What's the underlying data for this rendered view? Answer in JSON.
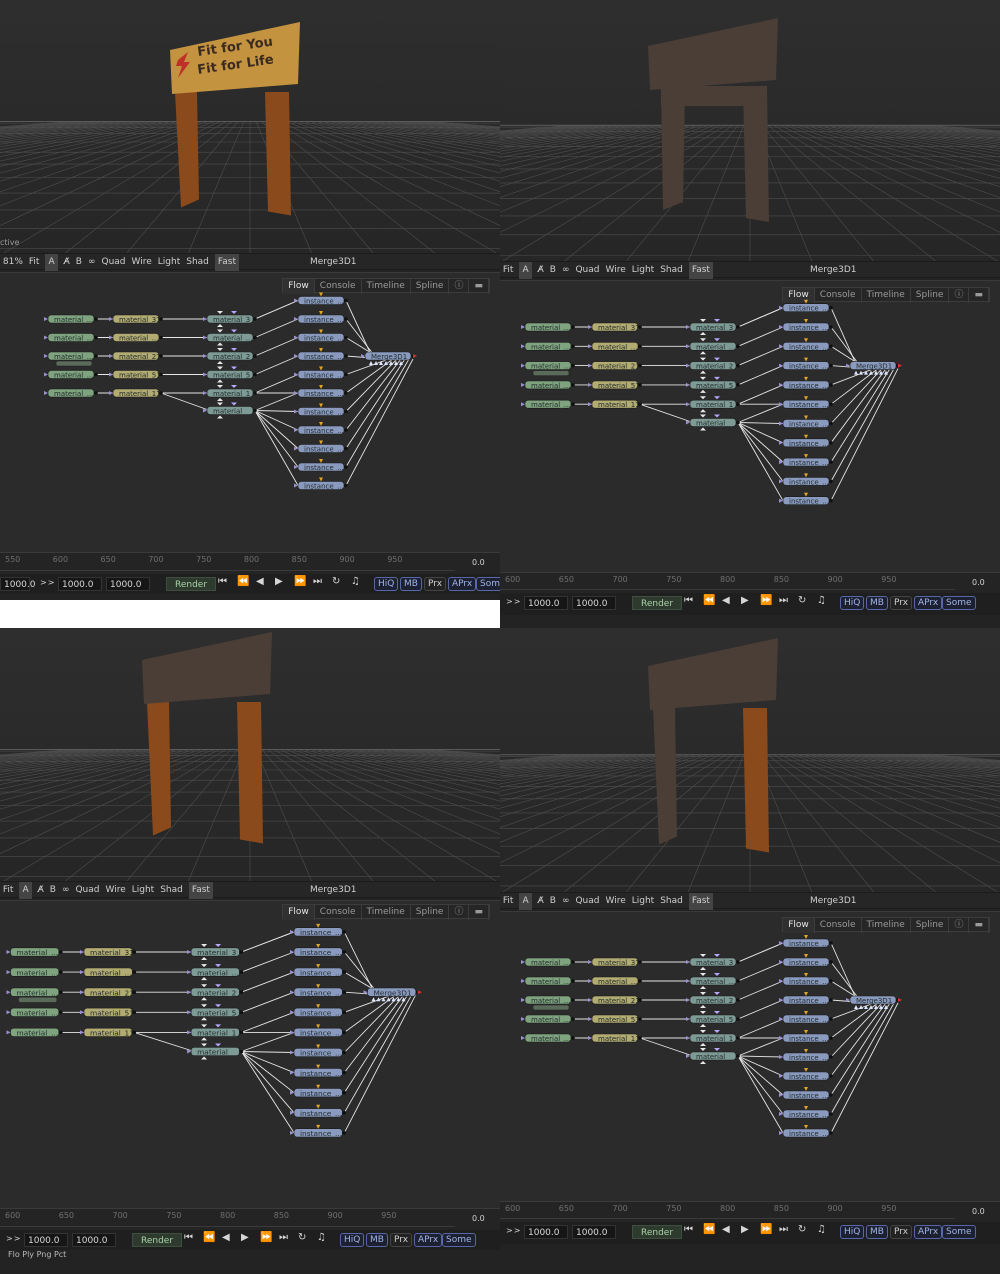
{
  "quadrants": [
    {
      "viewport": {
        "status_text": "ctive",
        "zoom": "81%",
        "fit": "Fit",
        "buttons": [
          "A",
          "B"
        ],
        "layout": "Quad",
        "modes": [
          "Wire",
          "Light",
          "Shad",
          "Fast"
        ],
        "title": "Merge3D1",
        "sign_text_1": "Fit for You",
        "sign_text_2": "Fit for Life"
      },
      "tabs": [
        "Flow",
        "Console",
        "Timeline",
        "Spline"
      ],
      "ticks": [
        "550",
        "600",
        "650",
        "700",
        "750",
        "800",
        "850",
        "900",
        "950"
      ],
      "current": "0.0",
      "transport": {
        "render_start": "1000.0",
        "render_end": "1000.0",
        "frame": "1000.0",
        "arrows": ">>",
        "render": "Render",
        "buttons": [
          "HiQ",
          "MB",
          "Prx",
          "APrx",
          "Some"
        ]
      }
    },
    {
      "viewport": {
        "fit": "Fit",
        "buttons": [
          "A",
          "B"
        ],
        "layout": "Quad",
        "modes": [
          "Wire",
          "Light",
          "Shad",
          "Fast"
        ],
        "title": "Merge3D1"
      },
      "tabs": [
        "Flow",
        "Console",
        "Timeline",
        "Spline"
      ],
      "ticks": [
        "600",
        "650",
        "700",
        "750",
        "800",
        "850",
        "900",
        "950"
      ],
      "current": "0.0",
      "transport": {
        "render_start": "1000.0",
        "render_end": "1000.0",
        "arrows": ">>",
        "render": "Render",
        "buttons": [
          "HiQ",
          "MB",
          "Prx",
          "APrx",
          "Some"
        ]
      }
    },
    {
      "viewport": {
        "fit": "Fit",
        "buttons": [
          "A",
          "B"
        ],
        "layout": "Quad",
        "modes": [
          "Wire",
          "Light",
          "Shad",
          "Fast"
        ],
        "title": "Merge3D1"
      },
      "tabs": [
        "Flow",
        "Console",
        "Timeline",
        "Spline"
      ],
      "ticks": [
        "600",
        "650",
        "700",
        "750",
        "800",
        "850",
        "900",
        "950"
      ],
      "current": "0.0",
      "transport": {
        "render_start": "1000.0",
        "render_end": "1000.0",
        "arrows": ">>",
        "render": "Render",
        "buttons": [
          "HiQ",
          "MB",
          "Prx",
          "APrx",
          "Some"
        ]
      },
      "bottom_tabs": "Flo  Ply  Png  Pct"
    },
    {
      "viewport": {
        "fit": "Fit",
        "buttons": [
          "A",
          "B"
        ],
        "layout": "Quad",
        "modes": [
          "Wire",
          "Light",
          "Shad",
          "Fast"
        ],
        "title": "Merge3D1"
      },
      "tabs": [
        "Flow",
        "Console",
        "Timeline",
        "Spline"
      ],
      "ticks": [
        "600",
        "650",
        "700",
        "750",
        "800",
        "850",
        "900",
        "950"
      ],
      "current": "0.0",
      "transport": {
        "render_start": "1000.0",
        "render_end": "1000.0",
        "arrows": ">>",
        "render": "Render",
        "buttons": [
          "HiQ",
          "MB",
          "Prx",
          "APrx",
          "Some"
        ]
      }
    }
  ],
  "nodes": {
    "loaders": [
      "material_...",
      "material_...",
      "material_...",
      "material_...",
      "material_..."
    ],
    "mats": [
      "material_31",
      "material_...",
      "material_21",
      "material_51",
      "material_11"
    ],
    "mids": [
      "material_3",
      "material_...",
      "material_2",
      "material_5",
      "material_1",
      "material"
    ],
    "instance": "instance_...",
    "merge": "Merge3D1"
  },
  "colors": {
    "loader": "#7fa37f",
    "mat": "#b2ab72",
    "mid": "#7e9a95",
    "instance": "#8a9abe",
    "merge": "#8a9abe",
    "sign_dark": "#4a3e37",
    "sign_wood": "#c4933f",
    "post_wood": "#8a4a1c",
    "grid": "#555555"
  }
}
